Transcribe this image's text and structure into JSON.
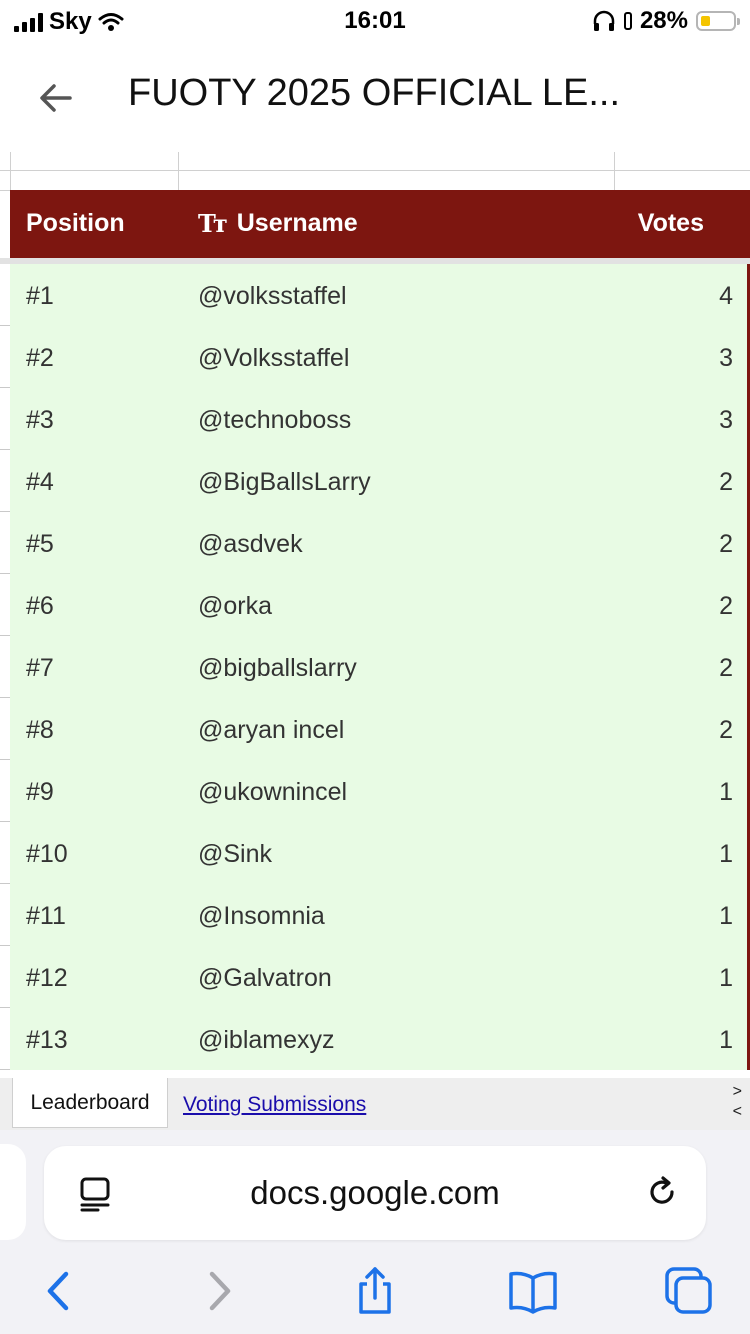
{
  "status": {
    "carrier": "Sky",
    "time": "16:01",
    "battery_percent": "28%",
    "battery_level": 0.28,
    "battery_color": "#f4c400"
  },
  "nav": {
    "title": "FUOTY 2025 OFFICIAL LE...",
    "back_icon": "back-arrow-icon"
  },
  "sheet": {
    "header": {
      "position": "Position",
      "username": "Username",
      "username_icon": "Tт",
      "votes": "Votes"
    },
    "header_color": "#7d1610",
    "row_color": "#e8fbe4",
    "rows": [
      {
        "position": "#1",
        "username": "@volksstaffel",
        "votes": "4"
      },
      {
        "position": "#2",
        "username": "@Volksstaffel",
        "votes": "3"
      },
      {
        "position": "#3",
        "username": "@technoboss",
        "votes": "3"
      },
      {
        "position": "#4",
        "username": "@BigBallsLarry",
        "votes": "2"
      },
      {
        "position": "#5",
        "username": "@asdvek",
        "votes": "2"
      },
      {
        "position": "#6",
        "username": "@orka",
        "votes": "2"
      },
      {
        "position": "#7",
        "username": "@bigballslarry",
        "votes": "2"
      },
      {
        "position": "#8",
        "username": "@aryan incel",
        "votes": "2"
      },
      {
        "position": "#9",
        "username": "@ukownincel",
        "votes": "1"
      },
      {
        "position": "#10",
        "username": "@Sink",
        "votes": "1"
      },
      {
        "position": "#11",
        "username": "@Insomnia",
        "votes": "1"
      },
      {
        "position": "#12",
        "username": "@Galvatron",
        "votes": "1"
      },
      {
        "position": "#13",
        "username": "@iblamexyz",
        "votes": "1"
      }
    ]
  },
  "tabs": {
    "active": "Leaderboard",
    "link": "Voting Submissions",
    "next": ">",
    "prev": "<"
  },
  "browser": {
    "url": "docs.google.com"
  }
}
